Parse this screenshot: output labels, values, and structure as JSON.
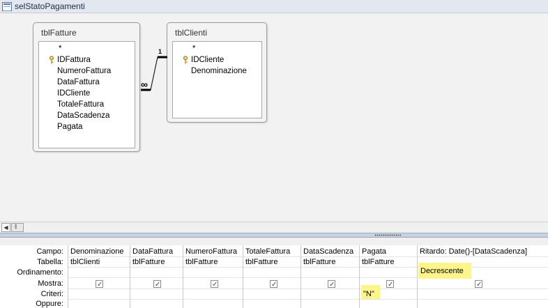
{
  "window": {
    "title": "selStatoPagamenti",
    "icon": "query-icon"
  },
  "tables": [
    {
      "name": "tblFatture",
      "fields": [
        "*",
        "IDFattura",
        "NumeroFattura",
        "DataFattura",
        "IDCliente",
        "TotaleFattura",
        "DataScadenza",
        "Pagata"
      ],
      "key_field": "IDFattura"
    },
    {
      "name": "tblClienti",
      "fields": [
        "*",
        "IDCliente",
        "Denominazione"
      ],
      "key_field": "IDCliente"
    }
  ],
  "relationship": {
    "many_label": "∞",
    "one_label": "1"
  },
  "grid": {
    "row_labels": [
      "Campo:",
      "Tabella:",
      "Ordinamento:",
      "Mostra:",
      "Criteri:",
      "Oppure:"
    ],
    "columns": [
      {
        "campo": "Denominazione",
        "tabella": "tblClienti",
        "ordinamento": "",
        "mostra": true,
        "criteri": ""
      },
      {
        "campo": "DataFattura",
        "tabella": "tblFatture",
        "ordinamento": "",
        "mostra": true,
        "criteri": ""
      },
      {
        "campo": "NumeroFattura",
        "tabella": "tblFatture",
        "ordinamento": "",
        "mostra": true,
        "criteri": ""
      },
      {
        "campo": "TotaleFattura",
        "tabella": "tblFatture",
        "ordinamento": "",
        "mostra": true,
        "criteri": ""
      },
      {
        "campo": "DataScadenza",
        "tabella": "tblFatture",
        "ordinamento": "",
        "mostra": true,
        "criteri": ""
      },
      {
        "campo": "Pagata",
        "tabella": "tblFatture",
        "ordinamento": "",
        "mostra": true,
        "criteri": "\"N\""
      },
      {
        "campo": "Ritardo: Date()-[DataScadenza]",
        "tabella": "",
        "ordinamento": "Decrescente",
        "mostra": true,
        "criteri": ""
      }
    ]
  },
  "colors": {
    "highlight": "#fbf58c",
    "check": "#1b4fa0",
    "splitter": "#c9d2df"
  }
}
